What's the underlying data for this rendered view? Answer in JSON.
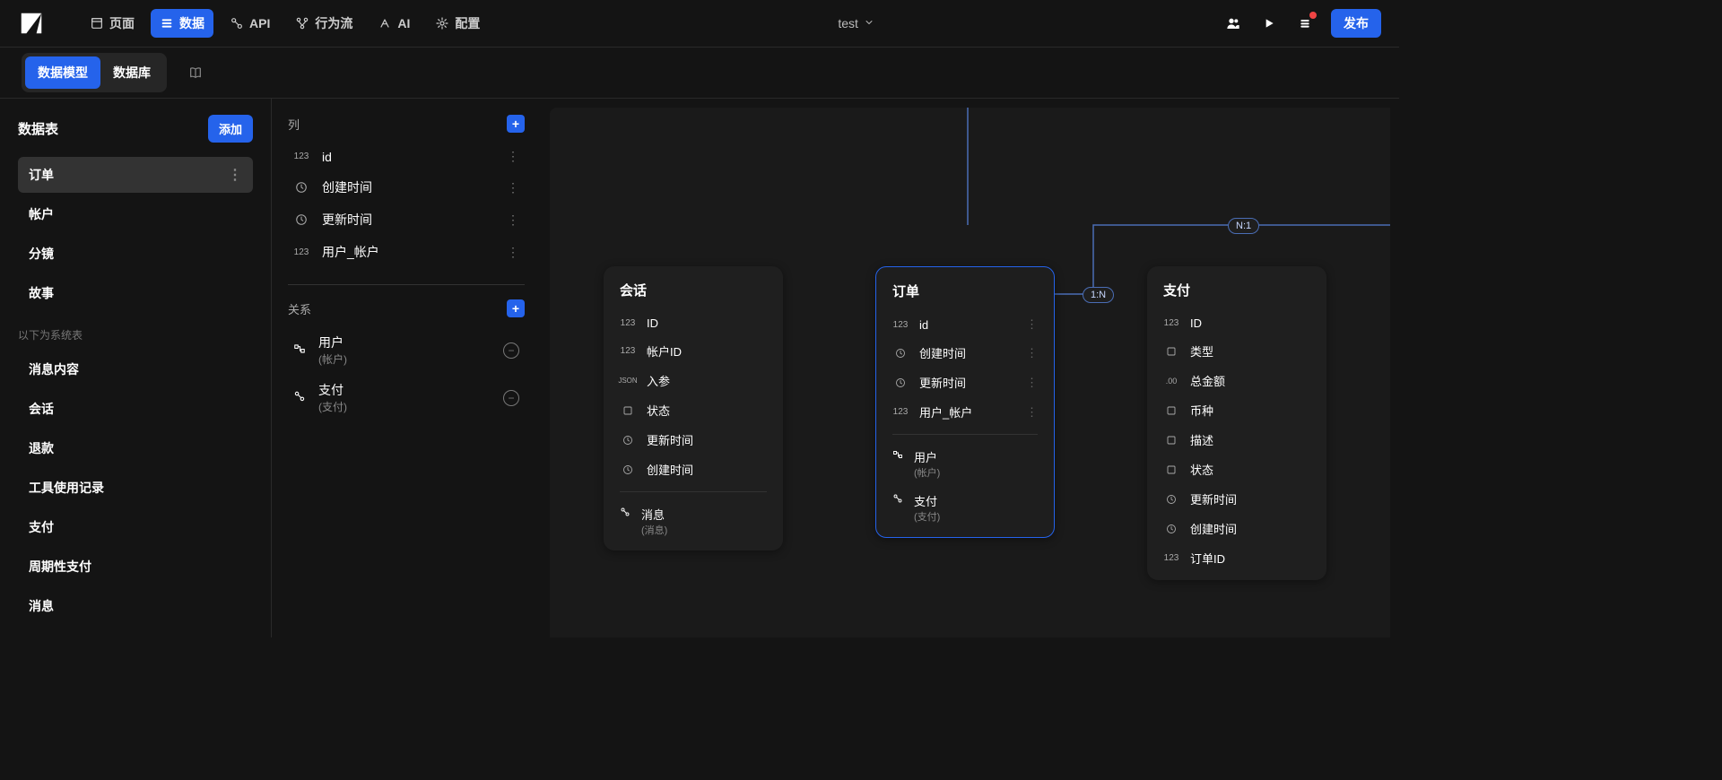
{
  "topbar": {
    "nav": [
      {
        "label": "页面",
        "icon": "page-icon"
      },
      {
        "label": "数据",
        "icon": "data-icon",
        "active": true
      },
      {
        "label": "API",
        "icon": "api-icon"
      },
      {
        "label": "行为流",
        "icon": "flow-icon"
      },
      {
        "label": "AI",
        "icon": "ai-icon"
      },
      {
        "label": "配置",
        "icon": "config-icon"
      }
    ],
    "project_name": "test",
    "publish_label": "发布"
  },
  "sub_toolbar": {
    "seg_model": "数据模型",
    "seg_db": "数据库"
  },
  "left": {
    "title": "数据表",
    "add_label": "添加",
    "tables": [
      {
        "label": "订单",
        "selected": true
      },
      {
        "label": "帐户"
      },
      {
        "label": "分镜"
      },
      {
        "label": "故事"
      }
    ],
    "system_label": "以下为系统表",
    "system_tables": [
      {
        "label": "消息内容"
      },
      {
        "label": "会话"
      },
      {
        "label": "退款"
      },
      {
        "label": "工具使用记录"
      },
      {
        "label": "支付"
      },
      {
        "label": "周期性支付"
      },
      {
        "label": "消息"
      }
    ]
  },
  "mid": {
    "columns_title": "列",
    "columns": [
      {
        "type": "123",
        "label": "id"
      },
      {
        "type": "clock",
        "label": "创建时间"
      },
      {
        "type": "clock",
        "label": "更新时间"
      },
      {
        "type": "123",
        "label": "用户_帐户"
      }
    ],
    "relations_title": "关系",
    "relations": [
      {
        "icon": "rel-fk",
        "label": "用户",
        "sub": "(帐户)"
      },
      {
        "icon": "rel-link",
        "label": "支付",
        "sub": "(支付)"
      }
    ]
  },
  "canvas": {
    "badges": {
      "one_n": "1:N",
      "n_one": "N:1"
    },
    "cards": [
      {
        "id": "session",
        "title": "会话",
        "rows": [
          {
            "type": "123",
            "label": "ID"
          },
          {
            "type": "123",
            "label": "帐户ID"
          },
          {
            "type": "json",
            "label": "入参"
          },
          {
            "type": "enum",
            "label": "状态"
          },
          {
            "type": "clock",
            "label": "更新时间"
          },
          {
            "type": "clock",
            "label": "创建时间"
          }
        ],
        "rels": [
          {
            "icon": "rel-link",
            "label": "消息",
            "sub": "(消息)"
          }
        ]
      },
      {
        "id": "order",
        "title": "订单",
        "selected": true,
        "rows": [
          {
            "type": "123",
            "label": "id"
          },
          {
            "type": "clock",
            "label": "创建时间"
          },
          {
            "type": "clock",
            "label": "更新时间"
          },
          {
            "type": "123",
            "label": "用户_帐户"
          }
        ],
        "rels": [
          {
            "icon": "rel-fk",
            "label": "用户",
            "sub": "(帐户)"
          },
          {
            "icon": "rel-link",
            "label": "支付",
            "sub": "(支付)"
          }
        ]
      },
      {
        "id": "payment",
        "title": "支付",
        "rows": [
          {
            "type": "123",
            "label": "ID"
          },
          {
            "type": "enum",
            "label": "类型"
          },
          {
            "type": "decimal",
            "label": "总金额"
          },
          {
            "type": "enum",
            "label": "币种"
          },
          {
            "type": "enum",
            "label": "描述"
          },
          {
            "type": "enum",
            "label": "状态"
          },
          {
            "type": "clock",
            "label": "更新时间"
          },
          {
            "type": "clock",
            "label": "创建时间"
          },
          {
            "type": "123",
            "label": "订单ID"
          }
        ]
      }
    ]
  }
}
